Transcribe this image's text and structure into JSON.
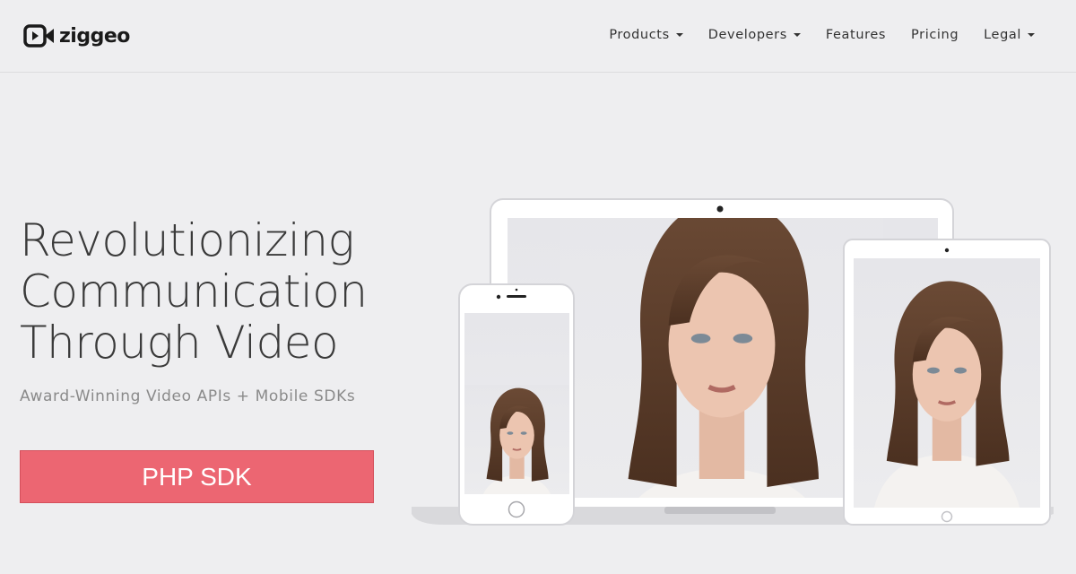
{
  "brand": {
    "name": "ziggeo"
  },
  "nav": {
    "items": [
      {
        "label": "Products",
        "dropdown": true
      },
      {
        "label": "Developers",
        "dropdown": true
      },
      {
        "label": "Features",
        "dropdown": false
      },
      {
        "label": "Pricing",
        "dropdown": false
      },
      {
        "label": "Legal",
        "dropdown": true
      }
    ]
  },
  "hero": {
    "headline_lines": [
      "Revolutionizing",
      "Communication",
      "Through Video"
    ],
    "subtitle": "Award-Winning Video APIs + Mobile SDKs",
    "cta_label": "PHP SDK"
  },
  "colors": {
    "background": "#eeeef0",
    "cta": "#ec6672",
    "text": "#3a3a3a"
  }
}
